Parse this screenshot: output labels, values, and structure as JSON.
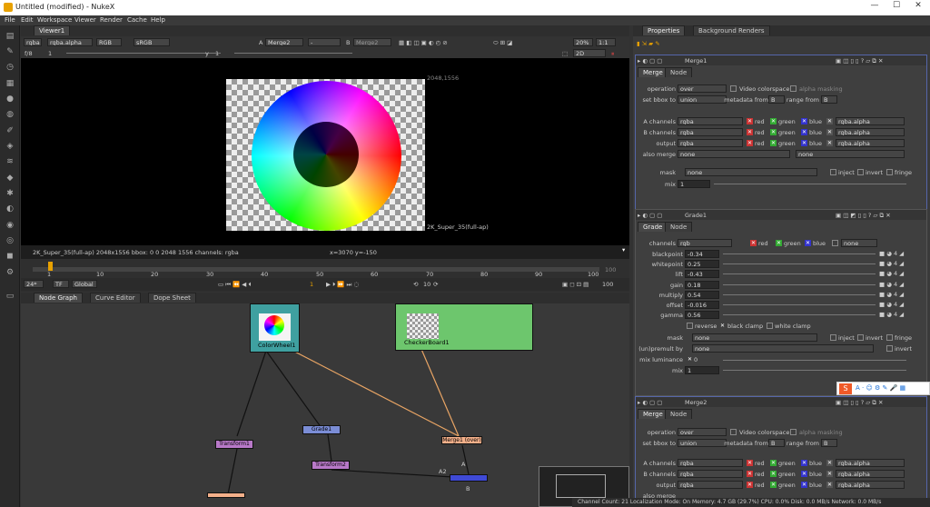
{
  "window": {
    "title": "Untitled (modified) - NukeX"
  },
  "menu": [
    "File",
    "Edit",
    "Workspace",
    "Viewer",
    "Render",
    "Cache",
    "Help"
  ],
  "viewer_tab": "Viewer1",
  "viewer_controls": {
    "channels": "rgba",
    "alpha": "rgba.alpha",
    "rgb": "RGB",
    "colorspace": "sRGB",
    "a_label": "A",
    "a_input": "Merge2",
    "dash": "-",
    "b_label": "B",
    "b_input": "Merge2",
    "zoom": "20%",
    "ratio": "1:1",
    "mode": "2D",
    "fstop": "f/8",
    "gain_val": "1",
    "y_label": "y",
    "gamma_val": "1"
  },
  "viewer_info": {
    "format_tr": "2048,1556",
    "format_br": "2K_Super_35(full-ap)",
    "status_left": "2K_Super_35(full-ap) 2048x1556  bbox: 0 0 2048 1556 channels: rgba",
    "status_mid": "x=3070 y=-150"
  },
  "timeline": {
    "ticks": [
      "1",
      "10",
      "20",
      "30",
      "40",
      "50",
      "60",
      "70",
      "80",
      "90",
      "100"
    ],
    "end": "100",
    "fps": "24*",
    "tf": "TF",
    "range": "Global",
    "frame": "1",
    "step": "10"
  },
  "graph_tabs": [
    "Node Graph",
    "Curve Editor",
    "Dope Sheet"
  ],
  "nodes": {
    "colorwheel": "ColorWheel1",
    "checkerboard": "CheckerBoard1",
    "grade": "Grade1",
    "transform1": "Transform1",
    "transform2": "Transform2",
    "merge": "Merge1 (over)",
    "a2": "A2",
    "a": "A",
    "b": "B"
  },
  "props_tabs": [
    "Properties",
    "Background Renders"
  ],
  "merge1": {
    "title": "Merge1",
    "tabs": [
      "Merge",
      "Node"
    ],
    "operation_label": "operation",
    "operation": "over",
    "video_cs": "Video colorspace",
    "alpha_masking": "alpha masking",
    "bbox_label": "set bbox to",
    "bbox": "union",
    "meta_label": "metadata from",
    "meta": "B",
    "range_label": "range from",
    "range": "B",
    "a_ch_label": "A channels",
    "a_ch": "rgba",
    "b_ch_label": "B channels",
    "b_ch": "rgba",
    "out_label": "output",
    "out": "rgba",
    "also_label": "also merge",
    "also": "none",
    "also2": "none",
    "red": "red",
    "green": "green",
    "blue": "blue",
    "alpha": "rgba.alpha",
    "mask_label": "mask",
    "mask": "none",
    "inject": "inject",
    "invert": "invert",
    "fringe": "fringe",
    "mix_label": "mix",
    "mix": "1"
  },
  "grade1": {
    "title": "Grade1",
    "tabs": [
      "Grade",
      "Node"
    ],
    "channels_label": "channels",
    "channels": "rgb",
    "red": "red",
    "green": "green",
    "blue": "blue",
    "none": "none",
    "rows": [
      {
        "label": "blackpoint",
        "value": "-0.34"
      },
      {
        "label": "whitepoint",
        "value": "0.25"
      },
      {
        "label": "lift",
        "value": "-0.43"
      },
      {
        "label": "gain",
        "value": "0.18"
      },
      {
        "label": "multiply",
        "value": "0.54"
      },
      {
        "label": "offset",
        "value": "-0.016"
      },
      {
        "label": "gamma",
        "value": "0.56"
      }
    ],
    "reverse": "reverse",
    "black_clamp": "black clamp",
    "white_clamp": "white clamp",
    "mask_label": "mask",
    "mask": "none",
    "inject": "inject",
    "invert": "invert",
    "fringe": "fringe",
    "unpremult_label": "(un)premult by",
    "unpremult": "none",
    "invert2": "invert",
    "mixlum_label": "mix luminance",
    "mixlum": "0",
    "mix_label": "mix",
    "mix": "1"
  },
  "merge2": {
    "title": "Merge2",
    "tabs": [
      "Merge",
      "Node"
    ],
    "operation_label": "operation",
    "operation": "over",
    "video_cs": "Video colorspace",
    "alpha_masking": "alpha masking",
    "bbox_label": "set bbox to",
    "bbox": "union",
    "meta_label": "metadata from",
    "meta": "B",
    "range_label": "range from",
    "range": "B",
    "a_ch_label": "A channels",
    "a_ch": "rgba",
    "b_ch_label": "B channels",
    "b_ch": "rgba",
    "out_label": "output",
    "out": "rgba",
    "also_label": "also merge",
    "red": "red",
    "green": "green",
    "blue": "blue",
    "alpha": "rgba.alpha"
  },
  "status_bar": "Channel Count: 21  Localization Mode: On  Memory: 4.7 GB (29.7%)  CPU: 0.0%  Disk: 0.0 MB/s  Network: 0.0 MB/s",
  "colors": {
    "accent": "#e8a100",
    "merge_node": "#f4b08a",
    "grade_node": "#7b8dd6",
    "transform_node": "#b879c8",
    "checker_bg": "#6dc66d",
    "wheel_bg": "#3fa0a0"
  }
}
